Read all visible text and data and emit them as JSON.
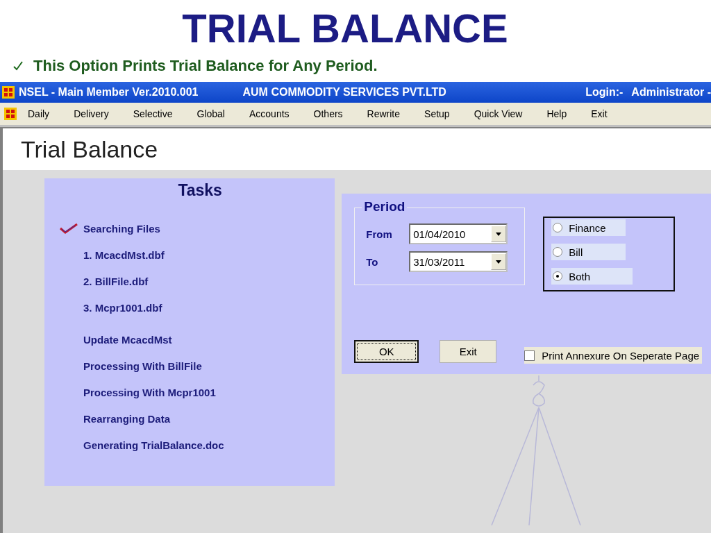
{
  "slide": {
    "title": "TRIAL BALANCE",
    "subtitle": "This Option Prints Trial Balance for Any Period."
  },
  "window": {
    "title": "NSEL - Main Member Ver.2010.001",
    "company": "AUM COMMODITY SERVICES PVT.LTD",
    "login_label": "Login:-",
    "login_user": "Administrator -"
  },
  "menu": [
    "Daily",
    "Delivery",
    "Selective",
    "Global",
    "Accounts",
    "Others",
    "Rewrite",
    "Setup",
    "Quick View",
    "Help",
    "Exit"
  ],
  "heading": "Trial Balance",
  "tasks": {
    "title": "Tasks",
    "items": [
      {
        "label": "Searching Files",
        "checked": true
      },
      {
        "label": "1. McacdMst.dbf",
        "checked": false
      },
      {
        "label": "2. BillFile.dbf",
        "checked": false
      },
      {
        "label": "3. Mcpr1001.dbf",
        "checked": false
      },
      {
        "label": "Update McacdMst",
        "checked": false
      },
      {
        "label": "Processing With BillFile",
        "checked": false
      },
      {
        "label": "Processing With Mcpr1001",
        "checked": false
      },
      {
        "label": "Rearranging Data",
        "checked": false
      },
      {
        "label": "Generating TrialBalance.doc",
        "checked": false
      }
    ]
  },
  "period": {
    "title": "Period",
    "fields": [
      {
        "label": "From",
        "value": "01/04/2010"
      },
      {
        "label": "To",
        "value": "31/03/2011"
      }
    ]
  },
  "report_type": [
    {
      "label": "Finance",
      "selected": false
    },
    {
      "label": "Bill",
      "selected": false
    },
    {
      "label": "Both",
      "selected": true
    }
  ],
  "buttons": [
    {
      "label": "OK",
      "focused": true
    },
    {
      "label": "Exit",
      "focused": false
    }
  ],
  "annexure_option": {
    "label": "Print Annexure On Seperate Page",
    "checked": false
  }
}
